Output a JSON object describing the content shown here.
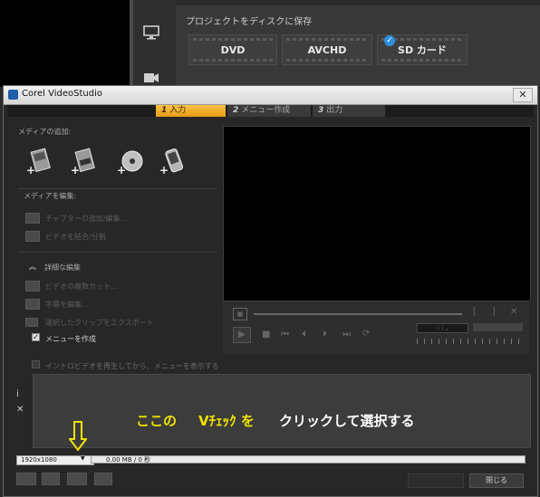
{
  "background_window": {
    "disk_section_title": "プロジェクトをディスクに保存",
    "disk_options": [
      {
        "label": "DVD"
      },
      {
        "label": "AVCHD"
      },
      {
        "label": "SD カード",
        "checked": true
      }
    ]
  },
  "dialog": {
    "title": "Corel VideoStudio",
    "close_glyph": "✕",
    "tabs": [
      {
        "num": "1",
        "label": "入力"
      },
      {
        "num": "2",
        "label": "メニュー作成"
      },
      {
        "num": "3",
        "label": "出力"
      }
    ],
    "add_media_label": "メディアの追加:",
    "edit_media_label": "メディアを編集:",
    "edit_items": [
      "チャプターの追加/編集...",
      "ビデオを結合/分割"
    ],
    "advanced_edit_label": "詳細な編集",
    "advanced_items": [
      "ビデオの複数カット...",
      "字幕を編集...",
      "選択したクリップをエクスポート"
    ],
    "create_menu_label": "メニューを作成",
    "create_menu_checked": true,
    "intro_label": "イントロビデオを再生してから、メニューを表示する",
    "intro_checked": false,
    "timecode": ": : ,",
    "resolution_value": "1920x1080",
    "size_text": "0.00 MB / 0 秒",
    "close_button": "閉じる",
    "side_icons": [
      "i",
      "✕"
    ]
  },
  "annotation": {
    "part1": "ここの",
    "part2": "Vﾁｪｯｸ を",
    "part3": "クリックして選択する",
    "color_yellow": "#f0e300"
  },
  "colors": {
    "tab_active": "#f0a520",
    "background": "#2a2a2a"
  }
}
